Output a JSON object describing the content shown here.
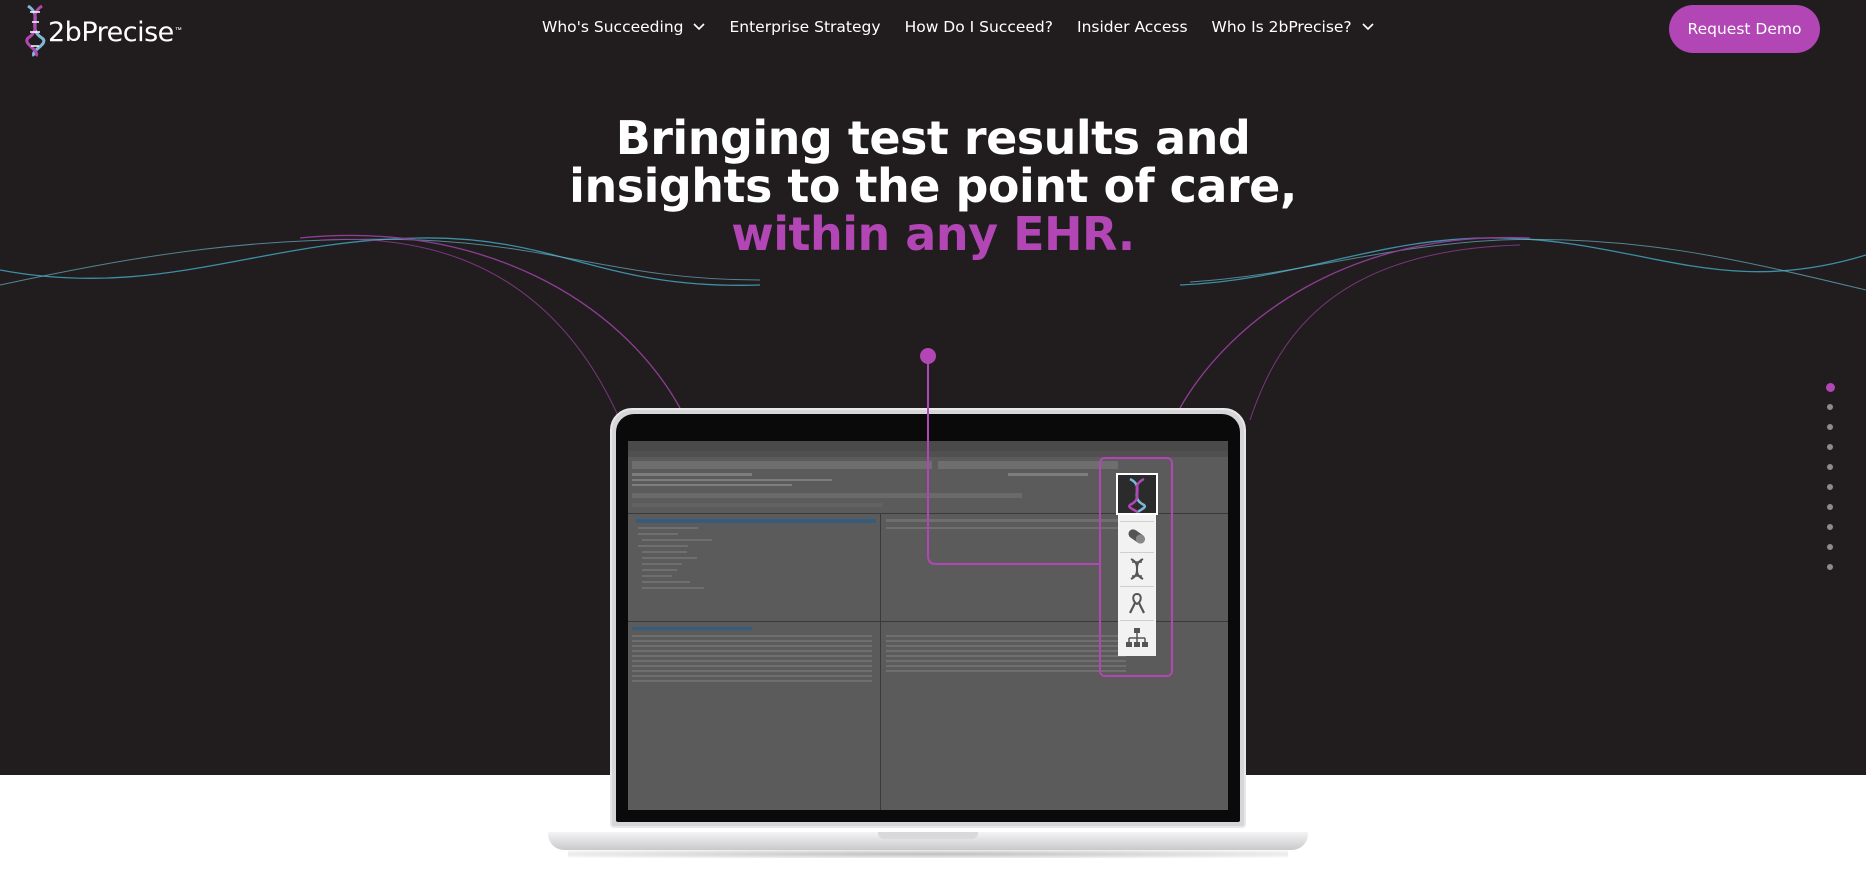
{
  "brand": {
    "name": "2bPrecise",
    "trademark": "™",
    "accent_color": "#b146b4",
    "background_color": "#211d1e"
  },
  "nav": {
    "items": [
      {
        "label": "Who's Succeeding",
        "has_dropdown": true
      },
      {
        "label": "Enterprise Strategy",
        "has_dropdown": false
      },
      {
        "label": "How Do I Succeed?",
        "has_dropdown": false
      },
      {
        "label": "Insider Access",
        "has_dropdown": false
      },
      {
        "label": "Who Is 2bPrecise?",
        "has_dropdown": true
      }
    ],
    "cta_label": "Request Demo"
  },
  "hero": {
    "line1": "Bringing test results and",
    "line2": "insights to the point of care,",
    "line3": "within any EHR."
  },
  "section_dots": {
    "count": 10,
    "active_index": 0
  },
  "plugin_icons": [
    "dna-logo-icon",
    "pill-icon",
    "dna-helix-icon",
    "ribbon-icon",
    "hierarchy-icon"
  ]
}
